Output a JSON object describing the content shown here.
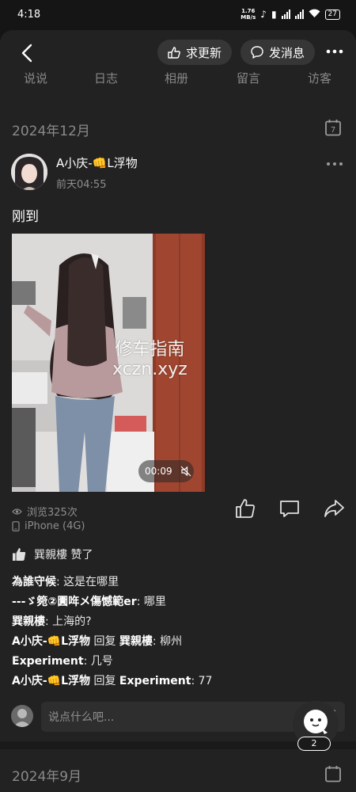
{
  "status": {
    "time": "4:18",
    "speed_value": "1.76",
    "speed_unit": "MB/s",
    "battery": "27"
  },
  "header": {
    "refresh_label": "求更新",
    "message_label": "发消息"
  },
  "tabs": [
    "说说",
    "日志",
    "相册",
    "留言",
    "访客"
  ],
  "sections": [
    {
      "date": "2024年12月",
      "cal_day": "7"
    },
    {
      "date": "2024年9月"
    }
  ],
  "post": {
    "username": "A小庆-👊L浮物",
    "time": "前天04:55",
    "text": "刚到",
    "video": {
      "duration": "00:09",
      "watermark_line1": "修车指南",
      "watermark_line2": "xczn.xyz"
    },
    "views": "浏览325次",
    "device": "iPhone (4G)",
    "likes": {
      "user": "巽親樓",
      "suffix": "赞了"
    },
    "comments": [
      {
        "author": "為誰守候",
        "text": "这是在哪里"
      },
      {
        "author": "---ゞ箢②圚哖メ傷憾範er",
        "text": "哪里"
      },
      {
        "author": "巽親樓",
        "text": "上海的?"
      },
      {
        "author": "A小庆-👊L浮物",
        "reply_word": "回复",
        "target": "巽親樓",
        "text": "柳州"
      },
      {
        "author": "Experiment",
        "text": "几号"
      },
      {
        "author": "A小庆-👊L浮物",
        "reply_word": "回复",
        "target": "Experiment",
        "text": "77"
      }
    ],
    "comment_placeholder": "说点什么吧..."
  },
  "float_badge": "2"
}
